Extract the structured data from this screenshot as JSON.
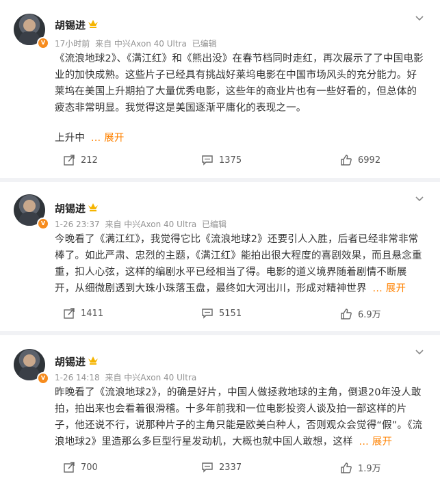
{
  "posts": [
    {
      "author": "胡锡进",
      "time": "17小时前",
      "source": "来自 中兴Axon 40 Ultra",
      "edited": "已编辑",
      "text": "《流浪地球2》、《满江红》和《熊出没》在春节档同时走红，再次展示了了中国电影业的加快成熟。这些片子已经具有挑战好莱坞电影在中国市场风头的充分能力。好莱坞在美国上升期拍了大量优秀电影，这些年的商业片也有一些好看的，但总体的疲态非常明显。我觉得这是美国逐渐平庸化的表现之一。",
      "tail": "上升中",
      "expand_label": "... 展开",
      "reposts": "212",
      "comments": "1375",
      "likes": "6992"
    },
    {
      "author": "胡锡进",
      "time": "1-26 23:37",
      "source": "来自 中兴Axon 40 Ultra",
      "edited": "已编辑",
      "text": "今晚看了《满江红》，我觉得它比《流浪地球2》还要引人入胜，后者已经非常非常棒了。如此严肃、忠烈的主题，《满江红》能拍出很大程度的喜剧效果，而且悬念重重，扣人心弦，这样的编剧水平已经相当了得。电影的道义境界随着剧情不断展开，从细微剧透到大珠小珠落玉盘，最终如大河出川，形成对精神世界",
      "tail": "",
      "expand_label": "... 展开",
      "reposts": "1411",
      "comments": "5151",
      "likes": "6.9万"
    },
    {
      "author": "胡锡进",
      "time": "1-26 14:18",
      "source": "来自 中兴Axon 40 Ultra",
      "edited": "",
      "text": "昨晚看了《流浪地球2》，的确是好片，中国人做拯救地球的主角，倒退20年没人敢拍，拍出来也会看着很滑稽。十多年前我和一位电影投资人谈及拍一部这样的片子，他还说不行，说那种片子的主角只能是欧美白种人，否则观众会觉得“假”。《流浪地球2》里造那么多巨型行星发动机，大概也就中国人敢想，这样",
      "tail": "",
      "expand_label": "... 展开",
      "reposts": "700",
      "comments": "2337",
      "likes": "1.9万"
    }
  ],
  "icons": {
    "more": "chevron-down-icon",
    "repost": "repost-icon",
    "comment": "comment-icon",
    "like": "like-icon",
    "crown": "crown-icon",
    "verified": "verified-badge-icon"
  },
  "colors": {
    "accent": "#ff8200",
    "meta": "#939393",
    "background": "#f1f2f5"
  }
}
